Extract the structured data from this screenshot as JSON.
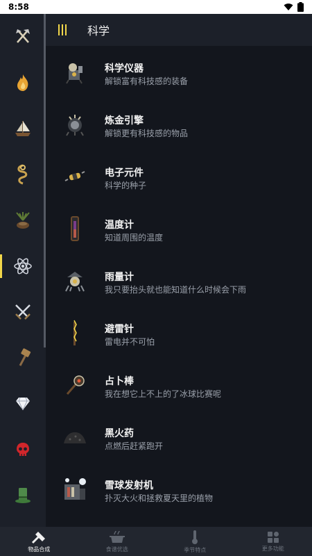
{
  "status": {
    "time": "8:58"
  },
  "sidebar": {
    "items": [
      {
        "icon": "axe-pickaxe-icon"
      },
      {
        "icon": "fire-icon"
      },
      {
        "icon": "boat-icon"
      },
      {
        "icon": "rope-icon"
      },
      {
        "icon": "farm-plant-icon"
      },
      {
        "icon": "atom-science-icon"
      },
      {
        "icon": "crossed-swords-icon"
      },
      {
        "icon": "hammer-icon"
      },
      {
        "icon": "diamond-icon"
      },
      {
        "icon": "red-skull-icon"
      },
      {
        "icon": "top-hat-icon"
      }
    ],
    "active_index": 5
  },
  "header": {
    "title": "科学"
  },
  "items": [
    {
      "name": "科学仪器",
      "desc": "解锁富有科技感的装备",
      "icon": "science-machine-icon"
    },
    {
      "name": "炼金引擎",
      "desc": "解锁更有科技感的物品",
      "icon": "alchemy-engine-icon"
    },
    {
      "name": "电子元件",
      "desc": "科学的种子",
      "icon": "electrical-doodad-icon"
    },
    {
      "name": "温度计",
      "desc": "知道周围的温度",
      "icon": "thermometer-icon"
    },
    {
      "name": "雨量计",
      "desc": "我只要抬头就也能知道什么时候会下雨",
      "icon": "rainometer-icon"
    },
    {
      "name": "避雷针",
      "desc": "雷电并不可怕",
      "icon": "lightning-rod-icon"
    },
    {
      "name": "占卜棒",
      "desc": "我在想它上不上的了冰球比赛呢",
      "icon": "divining-rod-icon"
    },
    {
      "name": "黑火药",
      "desc": "点燃后赶紧跑开",
      "icon": "gunpowder-icon"
    },
    {
      "name": "雪球发射机",
      "desc": "扑灭大火和拯救夏天里的植物",
      "icon": "ice-flingomatic-icon"
    }
  ],
  "bottom_nav": [
    {
      "label": "物品合成",
      "icon": "crafting-icon",
      "active": true
    },
    {
      "label": "食谱优选",
      "icon": "cooking-pot-icon",
      "active": false
    },
    {
      "label": "季节特点",
      "icon": "thermometer-season-icon",
      "active": false
    },
    {
      "label": "更多功能",
      "icon": "grid-more-icon",
      "active": false
    }
  ],
  "colors": {
    "accent": "#f2d74a",
    "background": "#13161d",
    "panel": "#1c2029",
    "nav": "#22262f"
  }
}
